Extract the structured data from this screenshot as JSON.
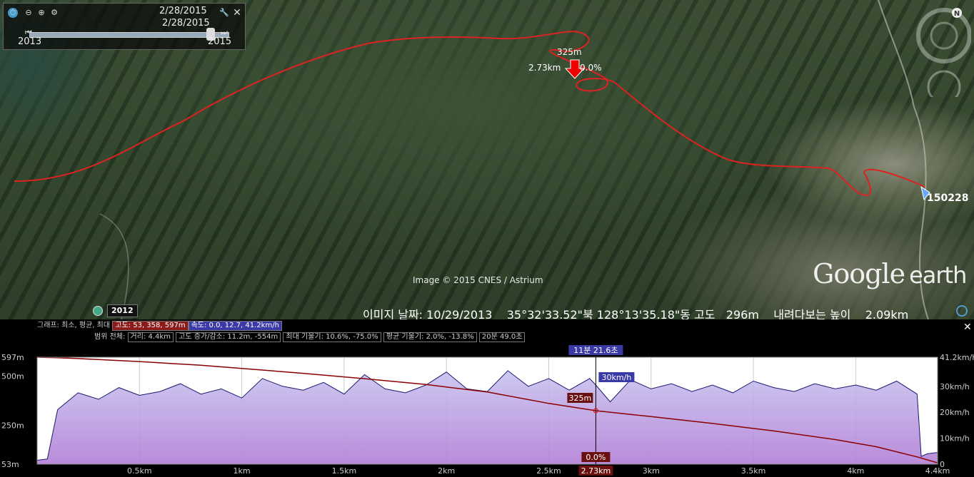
{
  "time_slider": {
    "date_top": "2/28/2015",
    "date_mid": "2/28/2015",
    "year_start": "2013",
    "year_end": "2015"
  },
  "map": {
    "elevation_label": "325m",
    "distance_label": "2.73km",
    "slope_label": "0.0%",
    "track_label": "150228",
    "attribution": "Image © 2015 CNES / Astrium",
    "logo_main": "Google",
    "logo_sub": "earth",
    "year_badge": "2012",
    "status": "이미지 날짜: 10/29/2013    35°32'33.52\"북 128°13'35.18\"동 고도   296m    내려다보는 높이    2.09km"
  },
  "profile": {
    "row1_prefix": "그래프: 최소, 평균, 최대",
    "elev_stats": "고도: 53, 358, 597m",
    "speed_stats": "속도: 0.0, 12.7, 41.2km/h",
    "row2_prefix": "범위 전체:",
    "distance_stat": "거리: 4.4km",
    "gain_stat": "고도 증가/감소: 11.2m, -554m",
    "slope_stat": "최대 기울기: 10.6%, -75.0%",
    "avg_slope_stat": "평균 기울기: 2.0%, -13.8%",
    "time_stat": "20분 49.0초",
    "cursor_time": "11분 21.6초",
    "cursor_speed": "30km/h",
    "cursor_elev": "325m",
    "cursor_slope": "0.0%",
    "cursor_dist": "2.73km"
  },
  "chart_data": {
    "type": "line",
    "x_unit": "km",
    "xlim": [
      0,
      4.4
    ],
    "x_ticks": [
      "0.5km",
      "1km",
      "1.5km",
      "2km",
      "2.5km",
      "3km",
      "3.5km",
      "4km",
      "4.4km"
    ],
    "y_left_ticks": [
      "597m",
      "500m",
      "250m",
      "53m"
    ],
    "y_left_lim": [
      53,
      597
    ],
    "y_right_ticks": [
      "41.2km/h",
      "30km/h",
      "20km/h",
      "10km/h",
      "0"
    ],
    "y_right_lim": [
      0,
      41.2
    ],
    "cursor_x": 2.73,
    "series": [
      {
        "name": "고도",
        "color": "#8b0000",
        "x": [
          0,
          0.1,
          0.2,
          0.3,
          0.5,
          0.8,
          1.0,
          1.3,
          1.6,
          1.9,
          2.2,
          2.5,
          2.73,
          3.0,
          3.3,
          3.6,
          3.9,
          4.1,
          4.3,
          4.4
        ],
        "values": [
          597,
          594,
          590,
          585,
          575,
          556,
          540,
          515,
          488,
          458,
          420,
          362,
          325,
          295,
          260,
          222,
          178,
          142,
          90,
          60
        ]
      },
      {
        "name": "속도",
        "color": "#1a1a6e",
        "x": [
          0,
          0.05,
          0.1,
          0.2,
          0.3,
          0.4,
          0.5,
          0.6,
          0.7,
          0.8,
          0.9,
          1.0,
          1.1,
          1.2,
          1.3,
          1.4,
          1.5,
          1.6,
          1.7,
          1.8,
          1.9,
          2.0,
          2.1,
          2.2,
          2.3,
          2.4,
          2.5,
          2.6,
          2.7,
          2.73,
          2.8,
          2.9,
          3.0,
          3.1,
          3.2,
          3.3,
          3.4,
          3.5,
          3.6,
          3.7,
          3.8,
          3.9,
          4.0,
          4.1,
          4.2,
          4.3,
          4.32,
          4.35,
          4.4
        ],
        "values": [
          1.5,
          2.0,
          21.0,
          27.5,
          25.0,
          29.5,
          26.5,
          28.0,
          31.0,
          27.0,
          29.0,
          25.5,
          33.0,
          30.0,
          28.5,
          31.5,
          27.0,
          34.5,
          29.0,
          27.5,
          30.5,
          35.5,
          29.0,
          28.0,
          36.0,
          30.0,
          33.0,
          28.5,
          33.0,
          30.5,
          24.0,
          32.5,
          29.0,
          31.0,
          28.0,
          30.5,
          27.5,
          32.0,
          29.5,
          28.0,
          31.0,
          29.0,
          30.5,
          28.5,
          32.0,
          27.0,
          3.0,
          4.0,
          4.5
        ]
      }
    ]
  }
}
